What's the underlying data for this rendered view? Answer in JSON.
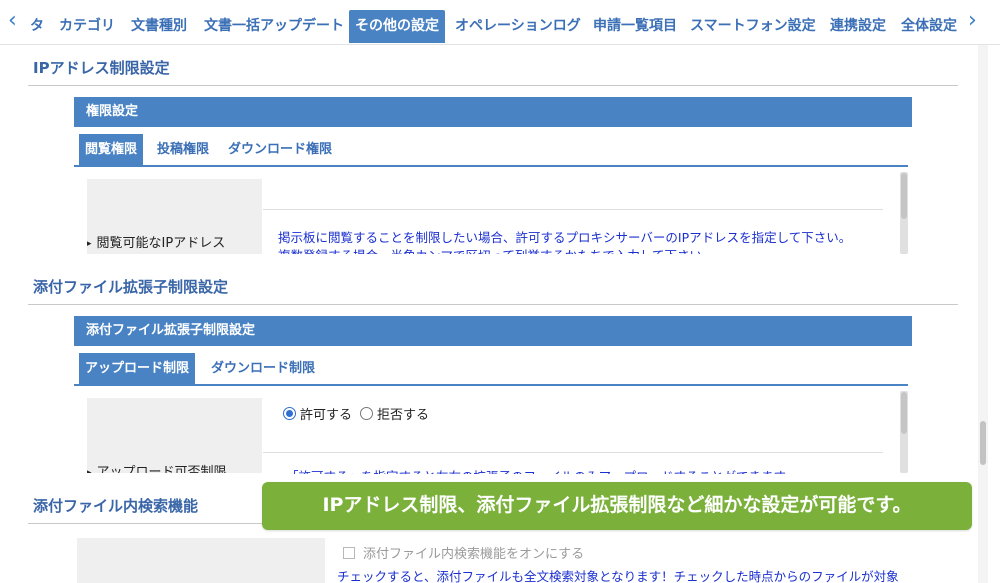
{
  "top_tabs": [
    "タ",
    "カテゴリ",
    "文書種別",
    "文書一括アップデート",
    "その他の設定",
    "オペレーションログ",
    "申請一覧項目",
    "スマートフォン設定",
    "連携設定",
    "全体設定"
  ],
  "active_tab_index": 4,
  "section_ip": {
    "title": "IPアドレス制限設定",
    "panel_title": "権限設定",
    "tabs": [
      "閲覧権限",
      "投稿権限",
      "ダウンロード権限"
    ],
    "row_label": "閲覧可能なIPアドレス",
    "line1": "掲示板に閲覧することを制限したい場合、許可するプロキシサーバーのIPアドレスを指定して下さい。",
    "line2": "複数登録する場合、半角カンマで区切って列挙するかたちで入力して下さい。"
  },
  "section_ext": {
    "title": "添付ファイル拡張子制限設定",
    "panel_title": "添付ファイル拡張子制限設定",
    "tabs": [
      "アップロード制限",
      "ダウンロード制限"
    ],
    "row_label": "アップロード可否制限",
    "radio_allow": "許可する",
    "radio_deny": "拒否する",
    "selected": "allow",
    "line1": "「許可する」を指定すると左右の拡張子のファイルのみアップロードすることができます。"
  },
  "section_search": {
    "title": "添付ファイル内検索機能",
    "checkbox_label": "添付ファイル内検索機能をオンにする",
    "line1": "チェックすると、添付ファイルも全文検索対象となります！チェックした時点からのファイルが対象"
  },
  "caption": "IPアドレス制限、添付ファイル拡張制限など細かな設定が可能です。",
  "colors": {
    "accent": "#4a83c4",
    "link_text": "#1a2fcf",
    "caption_bg": "#7bb13b"
  }
}
